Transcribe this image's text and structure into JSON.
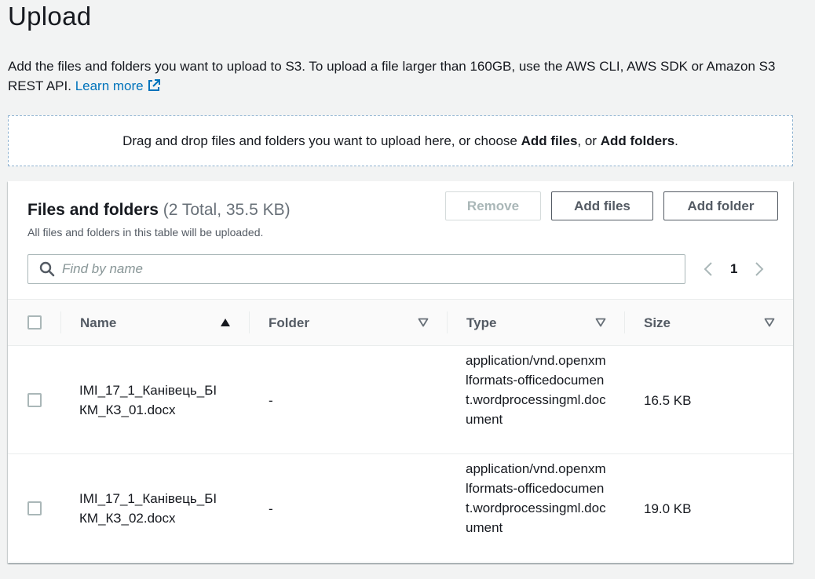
{
  "page": {
    "title": "Upload",
    "description": "Add the files and folders you want to upload to S3. To upload a file larger than 160GB, use the AWS CLI, AWS SDK or Amazon S3 REST API.",
    "learn_more": "Learn more"
  },
  "dropzone": {
    "text_1": "Drag and drop files and folders you want to upload here, or choose ",
    "add_files": "Add files",
    "text_2": ", or ",
    "add_folders": "Add folders",
    "text_3": "."
  },
  "panel": {
    "title": "Files and folders",
    "count": "(2 Total, 35.5 KB)",
    "subtitle": "All files and folders in this table will be uploaded.",
    "buttons": {
      "remove": "Remove",
      "add_files": "Add files",
      "add_folder": "Add folder"
    },
    "search": {
      "placeholder": "Find by name",
      "value": ""
    },
    "pagination": {
      "page": "1"
    }
  },
  "table": {
    "columns": [
      "Name",
      "Folder",
      "Type",
      "Size"
    ],
    "rows": [
      {
        "name_line1": "IMI_17_1_Канівець_БІ",
        "name_line2": "КМ_КЗ_01.docx",
        "folder": "-",
        "type": "application/vnd.openxmlformats-officedocument.wordprocessingml.document",
        "size": "16.5 KB"
      },
      {
        "name_line1": "IMI_17_1_Канівець_БІ",
        "name_line2": "КМ_КЗ_02.docx",
        "folder": "-",
        "type": "application/vnd.openxmlformats-officedocument.wordprocessingml.document",
        "size": "19.0 KB"
      }
    ]
  },
  "colors": {
    "link": "#0073bb",
    "text": "#16191f",
    "secondary": "#545b64",
    "disabled": "#aab7b8"
  }
}
